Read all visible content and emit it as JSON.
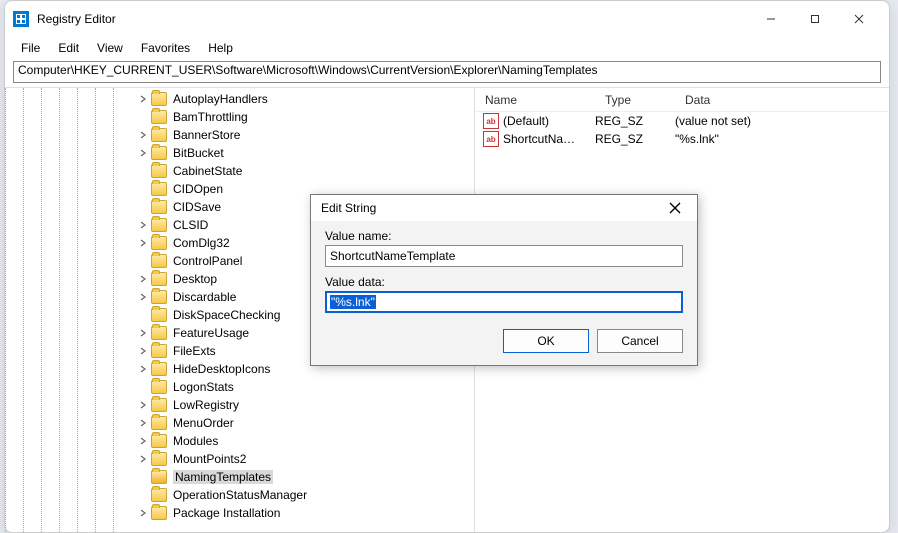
{
  "window": {
    "title": "Registry Editor"
  },
  "menu": {
    "file": "File",
    "edit": "Edit",
    "view": "View",
    "favorites": "Favorites",
    "help": "Help"
  },
  "address": "Computer\\HKEY_CURRENT_USER\\Software\\Microsoft\\Windows\\CurrentVersion\\Explorer\\NamingTemplates",
  "tree": [
    {
      "label": "AutoplayHandlers",
      "caret": "right"
    },
    {
      "label": "BamThrottling",
      "caret": "none"
    },
    {
      "label": "BannerStore",
      "caret": "right"
    },
    {
      "label": "BitBucket",
      "caret": "right"
    },
    {
      "label": "CabinetState",
      "caret": "none"
    },
    {
      "label": "CIDOpen",
      "caret": "none"
    },
    {
      "label": "CIDSave",
      "caret": "none"
    },
    {
      "label": "CLSID",
      "caret": "right"
    },
    {
      "label": "ComDlg32",
      "caret": "right"
    },
    {
      "label": "ControlPanel",
      "caret": "none"
    },
    {
      "label": "Desktop",
      "caret": "right"
    },
    {
      "label": "Discardable",
      "caret": "right"
    },
    {
      "label": "DiskSpaceChecking",
      "caret": "none"
    },
    {
      "label": "FeatureUsage",
      "caret": "right"
    },
    {
      "label": "FileExts",
      "caret": "right"
    },
    {
      "label": "HideDesktopIcons",
      "caret": "right"
    },
    {
      "label": "LogonStats",
      "caret": "none"
    },
    {
      "label": "LowRegistry",
      "caret": "right"
    },
    {
      "label": "MenuOrder",
      "caret": "right"
    },
    {
      "label": "Modules",
      "caret": "right"
    },
    {
      "label": "MountPoints2",
      "caret": "right"
    },
    {
      "label": "NamingTemplates",
      "caret": "none",
      "selected": true
    },
    {
      "label": "OperationStatusManager",
      "caret": "none"
    },
    {
      "label": "Package Installation",
      "caret": "right"
    }
  ],
  "list": {
    "headers": {
      "name": "Name",
      "type": "Type",
      "data": "Data"
    },
    "rows": [
      {
        "name": "(Default)",
        "type": "REG_SZ",
        "data": "(value not set)"
      },
      {
        "name": "ShortcutNa…",
        "type": "REG_SZ",
        "data": "\"%s.lnk\""
      }
    ]
  },
  "dialog": {
    "title": "Edit String",
    "value_name_label": "Value name:",
    "value_name": "ShortcutNameTemplate",
    "value_data_label": "Value data:",
    "value_data": "\"%s.lnk\"",
    "ok": "OK",
    "cancel": "Cancel"
  }
}
